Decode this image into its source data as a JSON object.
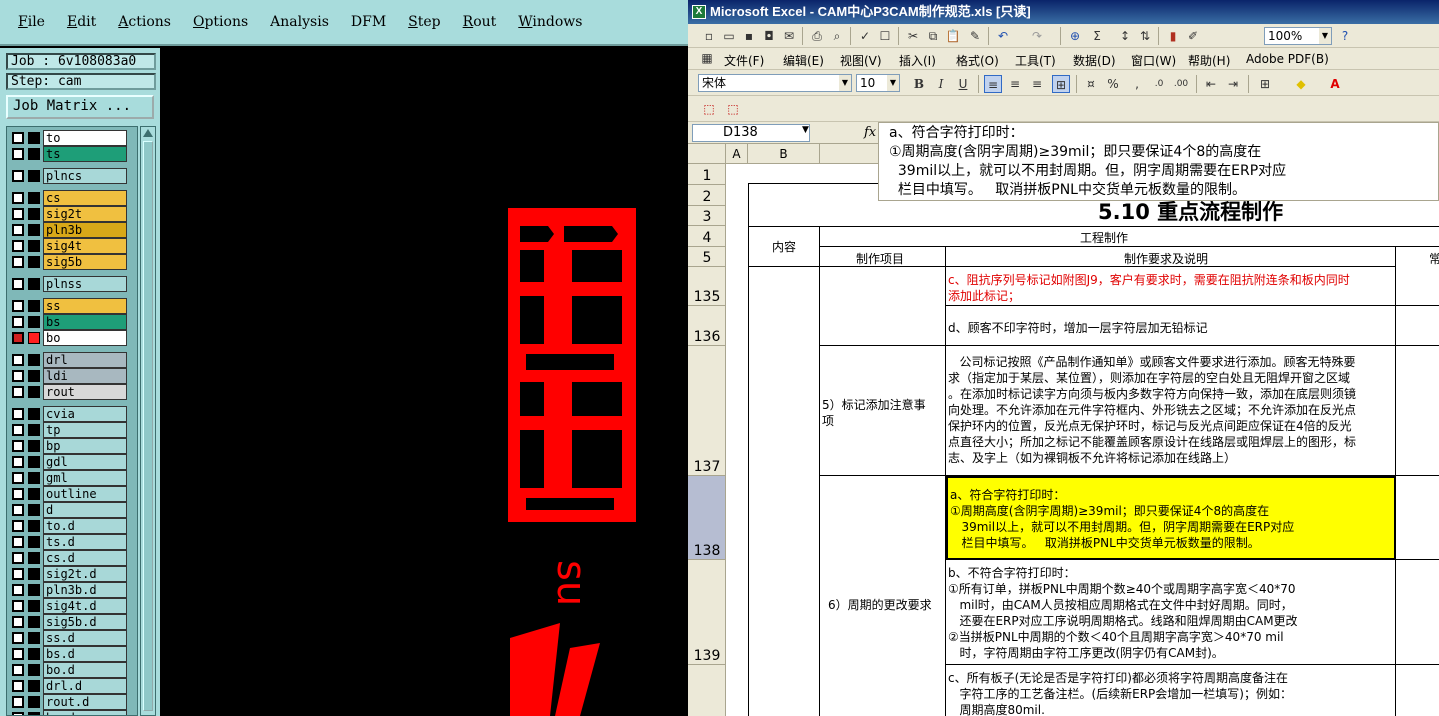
{
  "cam": {
    "menu": [
      {
        "u": "F",
        "rest": "ile"
      },
      {
        "u": "E",
        "rest": "dit"
      },
      {
        "u": "A",
        "rest": "ctions"
      },
      {
        "u": "O",
        "rest": "ptions"
      },
      {
        "u": "",
        "rest": "Analysis"
      },
      {
        "u": "",
        "rest": "DFM"
      },
      {
        "u": "S",
        "rest": "tep"
      },
      {
        "u": "R",
        "rest": "out"
      },
      {
        "u": "W",
        "rest": "indows"
      }
    ],
    "job_label": "Job : 6v108083a0",
    "step_label": "Step: cam",
    "job_matrix_button": "Job Matrix ...",
    "layers": [
      {
        "name": "to",
        "color": "#ffffff"
      },
      {
        "name": "ts",
        "color": "#1e9e78"
      },
      {
        "name": "plncs",
        "color": "#a8d8d8"
      },
      {
        "name": "cs",
        "color": "#f0c040"
      },
      {
        "name": "sig2t",
        "color": "#f0c040"
      },
      {
        "name": "pln3b",
        "color": "#d8a818"
      },
      {
        "name": "sig4t",
        "color": "#f0c040"
      },
      {
        "name": "sig5b",
        "color": "#f0c040"
      },
      {
        "name": "plnss",
        "color": "#a8d8d8"
      },
      {
        "name": "ss",
        "color": "#f0c040"
      },
      {
        "name": "bs",
        "color": "#1e9e78"
      },
      {
        "name": "bo",
        "color": "#ffffff"
      },
      {
        "name": "drl",
        "color": "#a8b8c0"
      },
      {
        "name": "ldi",
        "color": "#a8b8c0"
      },
      {
        "name": "rout",
        "color": "#d8d8d8"
      },
      {
        "name": "cvia",
        "color": "#a8d8d8"
      },
      {
        "name": "tp",
        "color": "#a8d8d8"
      },
      {
        "name": "bp",
        "color": "#a8d8d8"
      },
      {
        "name": "gdl",
        "color": "#a8d8d8"
      },
      {
        "name": "gml",
        "color": "#a8d8d8"
      },
      {
        "name": "outline",
        "color": "#a8d8d8"
      },
      {
        "name": "d",
        "color": "#a8d8d8"
      },
      {
        "name": "to.d",
        "color": "#a8d8d8"
      },
      {
        "name": "ts.d",
        "color": "#a8d8d8"
      },
      {
        "name": "cs.d",
        "color": "#a8d8d8"
      },
      {
        "name": "sig2t.d",
        "color": "#a8d8d8"
      },
      {
        "name": "pln3b.d",
        "color": "#a8d8d8"
      },
      {
        "name": "sig4t.d",
        "color": "#a8d8d8"
      },
      {
        "name": "sig5b.d",
        "color": "#a8d8d8"
      },
      {
        "name": "ss.d",
        "color": "#a8d8d8"
      },
      {
        "name": "bs.d",
        "color": "#a8d8d8"
      },
      {
        "name": "bo.d",
        "color": "#a8d8d8"
      },
      {
        "name": "drl.d",
        "color": "#a8d8d8"
      },
      {
        "name": "rout.d",
        "color": "#a8d8d8"
      },
      {
        "name": "bm.d",
        "color": "#a8d8d8"
      }
    ],
    "active_layer": "bo",
    "canvas_color": "#ff0000",
    "canvas_text": "su"
  },
  "excel": {
    "title": "Microsoft Excel - CAM中心P3CAM制作规范.xls [只读]",
    "menu": [
      "文件(F)",
      "编辑(E)",
      "视图(V)",
      "插入(I)",
      "格式(O)",
      "工具(T)",
      "数据(D)",
      "窗口(W)",
      "帮助(H)",
      "Adobe PDF(B)"
    ],
    "zoom": "100%",
    "font_name": "宋体",
    "font_size": "10",
    "name_box": "D138",
    "fx": "fx",
    "formula_lines": [
      "a、符合字符打印时：",
      "①周期高度(含阴字周期)≥39mil；即只要保证4个8的高度在",
      "  39mil以上，就可以不用封周期。但，阴字周期需要在ERP对应",
      "  栏目中填写。   取消拼板PNL中交货单元板数量的限制。"
    ],
    "columns": [
      "A",
      "B"
    ],
    "rows_top": [
      "1",
      "2",
      "3",
      "4",
      "5"
    ],
    "doc_title": "5.10 重点流程制作",
    "hdr_content": "内容",
    "hdr_process": "工程制作",
    "hdr_item": "制作项目",
    "hdr_req": "制作要求及说明",
    "hdr_extra": "常",
    "rows": [
      {
        "num": "135",
        "lines": [
          "c、阻抗序列号标记如附图J9，客户有要求时，需要在阻抗附连条和板内同时",
          "添加此标记；"
        ],
        "red": true
      },
      {
        "num": "136",
        "lines": [
          "d、顾客不印字符时，增加一层字符层加无铅标记"
        ]
      },
      {
        "num": "137",
        "item": [
          "5）标记添加注意事",
          "项"
        ],
        "lines": [
          "   公司标记按照《产品制作通知单》或顾客文件要求进行添加。顾客无特殊要",
          "求（指定加于某层、某位置），则添加在字符层的空白处且无阻焊开窗之区域",
          "。在添加时标记读字方向须与板内多数字符方向保持一致，添加在底层则须镜",
          "向处理。不允许添加在元件字符框内、外形铣去之区域；不允许添加在反光点",
          "保护环内的位置，反光点无保护环时，标记与反光点间距应保证在4倍的反光",
          "点直径大小；所加之标记不能覆盖顾客原设计在线路层或阻焊层上的图形，标",
          "志、及字上（如为裸铜板不允许将标记添加在线路上）"
        ]
      },
      {
        "num": "138",
        "lines": [
          "a、符合字符打印时：",
          "①周期高度(含阴字周期)≥39mil；即只要保证4个8的高度在",
          "   39mil以上，就可以不用封周期。但，阴字周期需要在ERP对应",
          "   栏目中填写。   取消拼板PNL中交货单元板数量的限制。"
        ],
        "highlight": "#ffff00"
      },
      {
        "num": "139",
        "item": [
          "6）周期的更改要求"
        ],
        "lines": [
          "b、不符合字符打印时：",
          "①所有订单，拼板PNL中周期个数≥40个或周期字高字宽＜40*70",
          "   mil时，由CAM人员按相应周期格式在文件中封好周期。同时，",
          "   还要在ERP对应工序说明周期格式。线路和阻焊周期由CAM更改",
          "②当拼板PNL中周期的个数＜40个且周期字高字宽＞40*70 mil",
          "   时，字符周期由字符工序更改(阴字仍有CAM封)。"
        ]
      },
      {
        "num": "",
        "lines": [
          "c、所有板子(无论是否是字符打印)都必须将字符周期高度备注在",
          "   字符工序的工艺备注栏。(后续新ERP会增加一栏填写)；例如：",
          "   周期高度80mil."
        ]
      }
    ]
  }
}
